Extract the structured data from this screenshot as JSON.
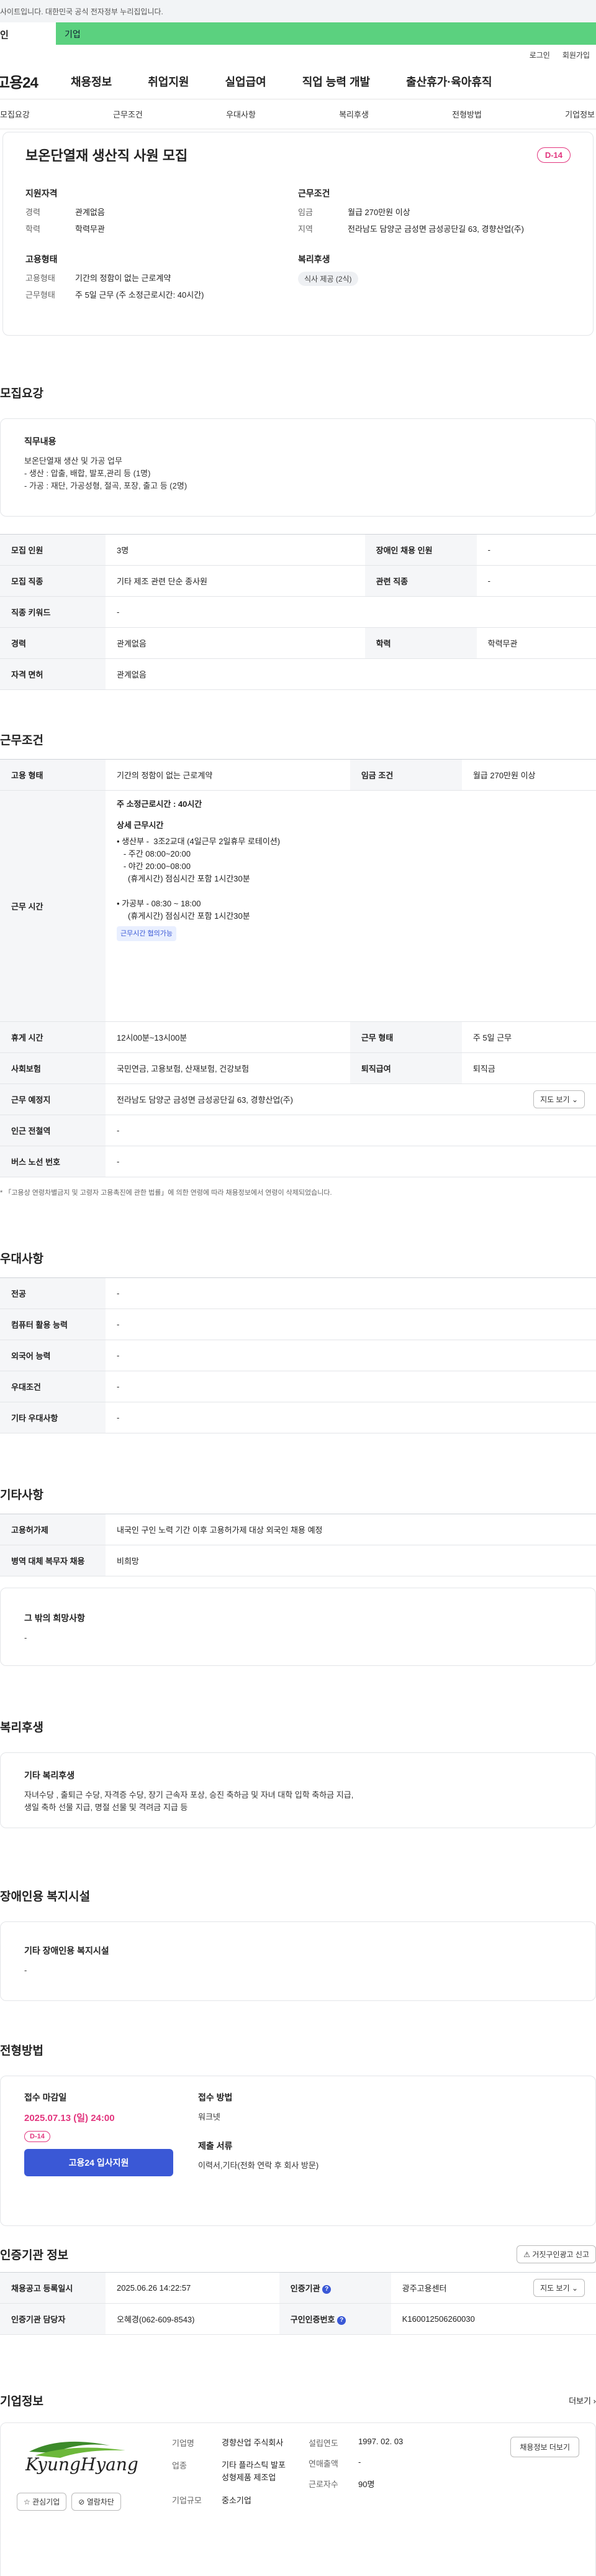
{
  "header": {
    "gov_notice": "사이트입니다. 대한민국 공식 전자정부 누리집입니다.",
    "tab_left": "인",
    "tab_right": "기업",
    "util": [
      "로그인",
      "회원가입"
    ],
    "logo": "고용24",
    "gnb": [
      "채용정보",
      "취업지원",
      "실업급여",
      "직업 능력 개발",
      "출산휴가·육아휴직"
    ],
    "subnav": [
      "모집요강",
      "근무조건",
      "우대사항",
      "복리후생",
      "전형방법",
      "기업정보"
    ]
  },
  "summary": {
    "title": "보온단열재 생산직 사원 모집",
    "dday": "D-14",
    "left": [
      {
        "heading": "지원자격",
        "rows": [
          {
            "k": "경력",
            "v": "관계없음"
          },
          {
            "k": "학력",
            "v": "학력무관"
          }
        ]
      },
      {
        "heading": "고용형태",
        "rows": [
          {
            "k": "고용형태",
            "v": "기간의 정함이 없는 근로계약"
          },
          {
            "k": "근무형태",
            "v": "주 5일 근무 (주 소정근로시간: 40시간)"
          }
        ]
      }
    ],
    "right": [
      {
        "heading": "근무조건",
        "rows": [
          {
            "k": "임금",
            "v": "월급 270만원 이상"
          },
          {
            "k": "지역",
            "v": "전라남도 담양군 금성면 금성공단길 63, 경향산업(주)"
          }
        ]
      },
      {
        "heading": "복리후생",
        "badge": "식사 제공 (2식)"
      }
    ]
  },
  "recruit": {
    "title": "모집요강",
    "job_box_heading": "직무내용",
    "job_lines": [
      "보온단열재 생산 및 가공 업무",
      "- 생산 : 압출, 배합, 발포,관리 등 (1명)",
      "- 가공 : 재단, 가공성형, 절곡, 포장, 출고 등 (2명)"
    ],
    "rows": [
      [
        "모집 인원",
        "3명",
        "장애인 채용 인원",
        "-"
      ],
      [
        "모집 직종",
        "기타 제조 관련 단순 종사원",
        "관련 직종",
        "-"
      ],
      [
        "직종 키워드",
        "-",
        "",
        ""
      ],
      [
        "경력",
        "관계없음",
        "학력",
        "학력무관"
      ],
      [
        "자격 면허",
        "관계없음",
        "",
        ""
      ]
    ]
  },
  "work": {
    "title": "근무조건",
    "employ_type_label": "고용 형태",
    "employ_type": "기간의 정함이 없는 근로계약",
    "wage_label": "임금 조건",
    "wage": "월급 270만원 이상",
    "hours_label": "근무 시간",
    "hours_total": "주 소정근로시간 : 40시간",
    "hours_detail_title": "상세 근무시간",
    "hours_lines": [
      "• 생산부 -  3조2교대 (4일근무 2일휴무 로테이션)",
      "   - 주간 08:00~20:00",
      "   - 야간 20:00~08:00",
      "     (휴게시간) 점심시간 포함 1시간30분",
      "",
      "• 가공부 - 08:30 ~ 18:00",
      "     (휴게시간) 점심시간 포함 1시간30분"
    ],
    "hours_chip": "근무시간 협의가능",
    "rows": [
      [
        "휴게 시간",
        "12시00분~13시00분",
        "근무 형태",
        "주 5일 근무"
      ],
      [
        "사회보험",
        "국민연금, 고용보험, 산재보험, 건강보험",
        "퇴직급여",
        "퇴직금"
      ]
    ],
    "place_label": "근무 예정지",
    "place": "전라남도 담양군 금성면 금성공단길 63, 경향산업(주)",
    "map_btn": "지도 보기",
    "station_label": "인근 전철역",
    "station": "-",
    "bus_label": "버스 노선 번호",
    "bus": "-",
    "note": "* 「고용상 연령차별금지 및 고령자 고용촉진에 관한 법률」에 의한 연령에 따라 채용정보에서 연령이 삭제되었습니다."
  },
  "pref": {
    "title": "우대사항",
    "rows": [
      [
        "전공",
        "-"
      ],
      [
        "컴퓨터 활용 능력",
        "-"
      ],
      [
        "외국어 능력",
        "-"
      ],
      [
        "우대조건",
        "-"
      ],
      [
        "기타 우대사항",
        "-"
      ]
    ]
  },
  "etc": {
    "title": "기타사항",
    "rows": [
      [
        "고용허가제",
        "내국인 구인 노력 기간 이후 고용허가제 대상 외국인 채용 예정"
      ],
      [
        "병역 대체 복무자 채용",
        "비희망"
      ]
    ],
    "box_heading": "그 밖의 희망사항",
    "box_value": "-"
  },
  "welfare": {
    "title": "복리후생",
    "box_heading": "기타 복리후생",
    "box_lines": [
      "자녀수당 , 출퇴근 수당, 자격증 수당, 장기 근속자 포상, 승진 축하금 및 자녀 대학 입학 축하금 지급,",
      "생일 축하 선물 지급, 명절 선물 및 격려금 지급 등"
    ]
  },
  "disabled": {
    "title": "장애인용 복지시설",
    "box_heading": "기타 장애인용 복지시설",
    "box_value": "-"
  },
  "selection": {
    "title": "전형방법",
    "deadline_label": "접수 마감일",
    "deadline": "2025.07.13 (일) 24:00",
    "dday": "D-14",
    "apply_btn": "고용24 입사지원",
    "method_label": "접수 방법",
    "method": "워크넷",
    "docs_label": "제출 서류",
    "docs": "이력서,기타(전화  연락 후 회사 방문)"
  },
  "agency": {
    "title": "인증기관 정보",
    "report_btn": "거짓구인광고 신고",
    "rows": [
      [
        "채용공고 등록일시",
        "2025.06.26 14:22:57",
        "인증기관",
        "광주고용센터"
      ],
      [
        "인증기관 담당자",
        "오혜경(062-609-8543)",
        "구인인증번호",
        "K160012506260030"
      ]
    ],
    "map_btn": "지도 보기"
  },
  "company": {
    "title": "기업정보",
    "more": "더보기",
    "logo_text": "KyungHyang",
    "fav_btn": "관심기업",
    "block_btn": "열람차단",
    "left": [
      [
        "기업명",
        "경향산업 주식회사"
      ],
      [
        "업종",
        "기타 플라스틱 발포 성형제품 제조업"
      ],
      [
        "기업규모",
        "중소기업"
      ]
    ],
    "right": [
      [
        "설립연도",
        "1997. 02. 03"
      ],
      [
        "연매출액",
        "-"
      ],
      [
        "근로자수",
        "90명"
      ]
    ],
    "jobs_btn": "채용정보 더보기"
  },
  "colors": {
    "accent_pink": "#e2357e",
    "accent_blue": "#3a58d6",
    "green_tab": "#5bd17f"
  }
}
